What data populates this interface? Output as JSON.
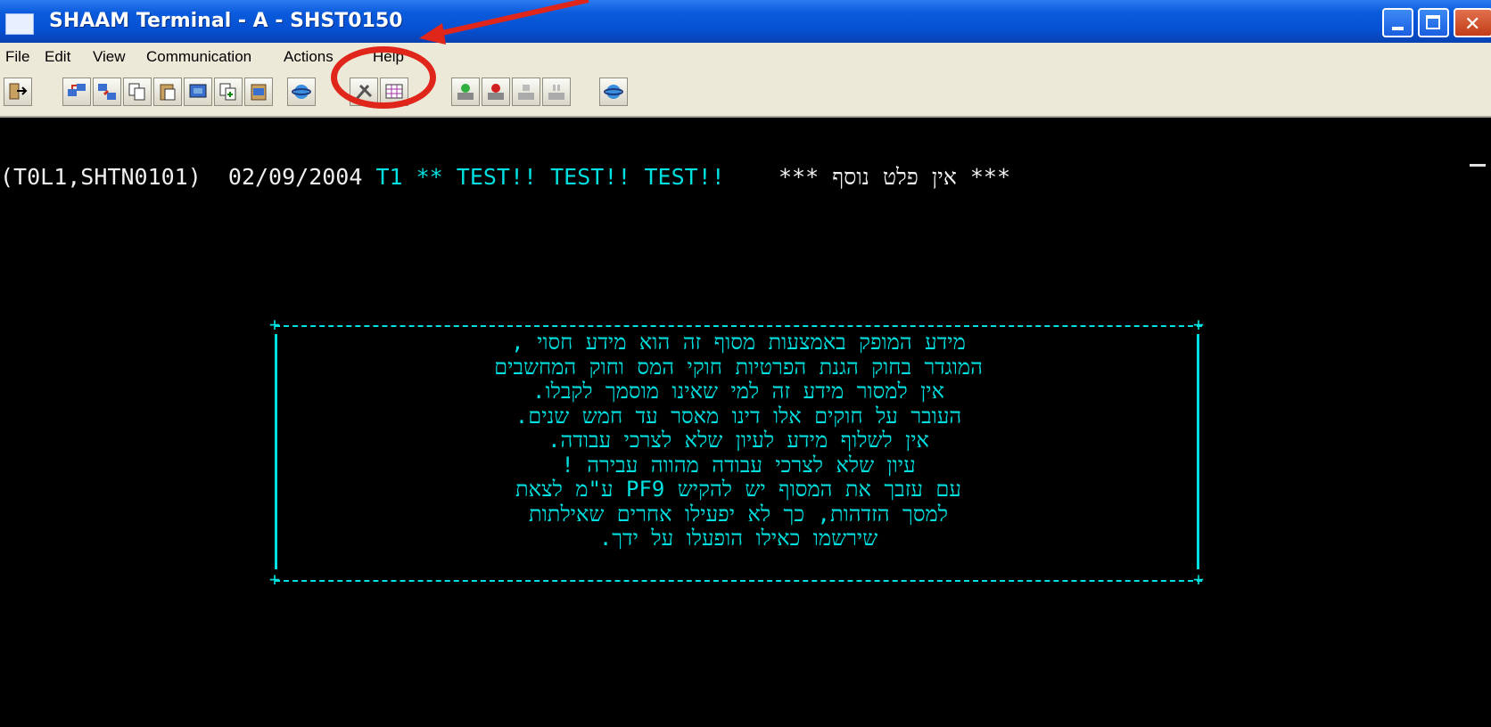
{
  "window": {
    "title": "SHAAM Terminal - A - SHST0150",
    "accent_color": "#0a5bdc",
    "close_color": "#c23d17",
    "close_glyph": "✕"
  },
  "menu": {
    "items": [
      "File",
      "Edit",
      "View",
      "Communication",
      "Actions",
      "Help"
    ]
  },
  "toolbar": {
    "icons": [
      "exit-icon",
      "connect-icon",
      "transfer-icon",
      "copy-icon",
      "paste-icon",
      "screen-icon",
      "copy-append-icon",
      "clipboard-screen-icon",
      "globe-icon",
      "settings-tools-icon",
      "keypad-grid-icon",
      "macro-record-icon",
      "macro-play-icon",
      "macro-stop-icon",
      "macro-pause-icon",
      "globe-icon-2"
    ]
  },
  "terminal": {
    "text_color": "#00e0e0",
    "status_line": {
      "ids": "(T0L1,SHTN0101)",
      "date": "02/09/2004",
      "label": " T1 ** TEST!! TEST!! TEST!!    ",
      "warning": "*** אין פלט נוסף ***"
    },
    "notice_lines": [
      "מידע המופק באמצעות מסוף זה הוא מידע חסוי ,",
      "המוגדר בחוק הגנת הפרטיות חוקי המס וחוק המחשבים",
      "אין למסור מידע זה למי שאינו מוסמך לקבלו.",
      "העובר על חוקים אלו דינו מאסר עד חמש שנים.",
      "אין לשלוף מידע לעיון שלא לצרכי עבודה.",
      "עיון שלא לצרכי עבודה מהווה עבירה !",
      "עם עזבך את המסוף יש להקיש PF9 ע\"מ לצאת",
      "למסך הזדהות, כך לא יפעילו אחרים שאילתות",
      "שירשמו כאילו הופעלו על ידך."
    ]
  },
  "annotation": {
    "color": "#e0261a",
    "highlights": "Actions"
  }
}
